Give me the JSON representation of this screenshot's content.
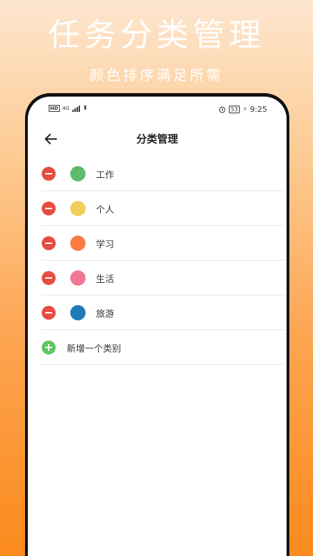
{
  "promo": {
    "title": "任务分类管理",
    "subtitle": "颜色排序满足所需"
  },
  "statusbar": {
    "left_badge": "HD",
    "network": "4G",
    "right_icons": [
      "alarm-icon",
      "battery-icon",
      "charging-icon"
    ],
    "battery": "53",
    "time": "9:25"
  },
  "header": {
    "title": "分类管理",
    "back_icon": "arrow-left-icon"
  },
  "categories": [
    {
      "label": "工作",
      "color": "#5dbb6c"
    },
    {
      "label": "个人",
      "color": "#f2cf5b"
    },
    {
      "label": "学习",
      "color": "#fb7b43"
    },
    {
      "label": "生活",
      "color": "#ef7995"
    },
    {
      "label": "旅游",
      "color": "#1f7ab8"
    }
  ],
  "add": {
    "label": "新增一个类别",
    "color": "#5fc85f"
  },
  "colors": {
    "delete": "#e54d42",
    "add": "#5fc85f",
    "gradient_top": "#fde6cf",
    "gradient_bottom": "#fb8a1c"
  }
}
